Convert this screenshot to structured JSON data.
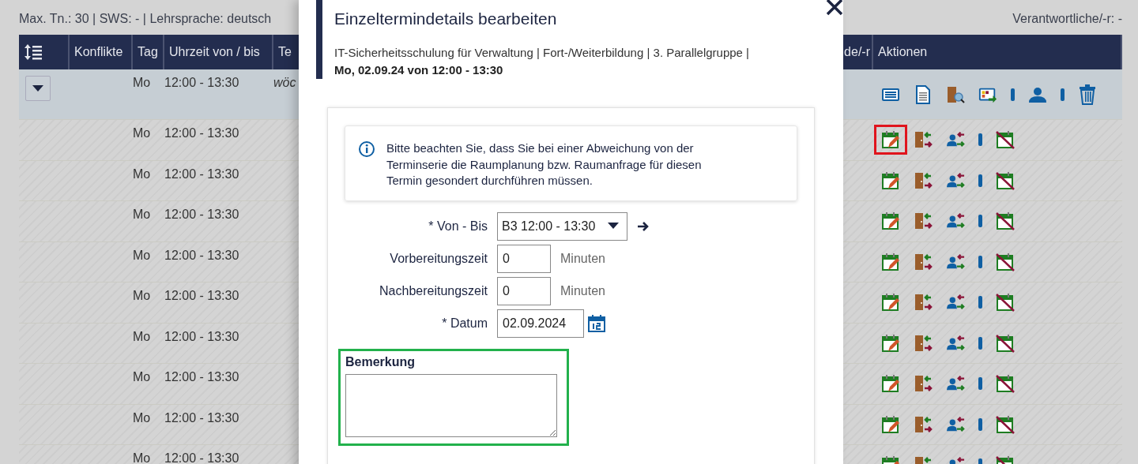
{
  "summary": "Max. Tn.: 30 | SWS: - | Lehrsprache: deutsch",
  "responsible": "Verantwortliche/-r: -",
  "table": {
    "columns": [
      {
        "kind": "icon"
      },
      {
        "kind": "text",
        "label": "Konflikte"
      },
      {
        "kind": "text",
        "label": "Tag"
      },
      {
        "kind": "text",
        "label": "Uhrzeit von / bis"
      },
      {
        "kind": "text",
        "label": "Te"
      },
      {
        "kind": "text",
        "label": "de/-r"
      },
      {
        "kind": "text",
        "label": "Aktionen"
      }
    ],
    "rows": [
      {
        "kind": "series",
        "day": "Mo",
        "time": "12:00 - 13:30",
        "column_5": "wöc"
      },
      {
        "kind": "date",
        "day": "Mo",
        "time": "12:00 - 13:30",
        "highlighted": true
      },
      {
        "kind": "date",
        "day": "Mo",
        "time": "12:00 - 13:30",
        "highlighted": false
      },
      {
        "kind": "date",
        "day": "Mo",
        "time": "12:00 - 13:30",
        "highlighted": false
      },
      {
        "kind": "date",
        "day": "Mo",
        "time": "12:00 - 13:30",
        "highlighted": false
      },
      {
        "kind": "date",
        "day": "Mo",
        "time": "12:00 - 13:30",
        "highlighted": false
      },
      {
        "kind": "date",
        "day": "Mo",
        "time": "12:00 - 13:30",
        "highlighted": false
      },
      {
        "kind": "date",
        "day": "Mo",
        "time": "12:00 - 13:30",
        "highlighted": false
      },
      {
        "kind": "date",
        "day": "Mo",
        "time": "12:00 - 13:30",
        "highlighted": false
      },
      {
        "kind": "date",
        "day": "Mo",
        "time": "12:00 - 13:30",
        "highlighted": false
      }
    ]
  },
  "dialog": {
    "title": "Einzeltermindetails bearbeiten",
    "subtitle": "IT-Sicherheitsschulung für Verwaltung | Fort-/Weiterbildung | 3. Parallelgruppe |",
    "subtitle_date": "Mo, 02.09.24 von 12:00 - 13:30",
    "info": "Bitte beachten Sie, dass Sie bei einer Abweichung von der Terminserie die Raumplanung bzw. Raumanfrage für diesen Termin gesondert durchführen müssen.",
    "fields": [
      {
        "kind": "select",
        "label": "* Von - Bis",
        "value": "B3 12:00 - 13:30"
      },
      {
        "kind": "number",
        "label": "Vorbereitungszeit",
        "value": "0",
        "unit": "Minuten"
      },
      {
        "kind": "number",
        "label": "Nachbereitungszeit",
        "value": "0",
        "unit": "Minuten"
      },
      {
        "kind": "date",
        "label": "* Datum",
        "value": "02.09.2024"
      }
    ],
    "remark": {
      "label": "Bemerkung",
      "highlighted": true
    }
  }
}
